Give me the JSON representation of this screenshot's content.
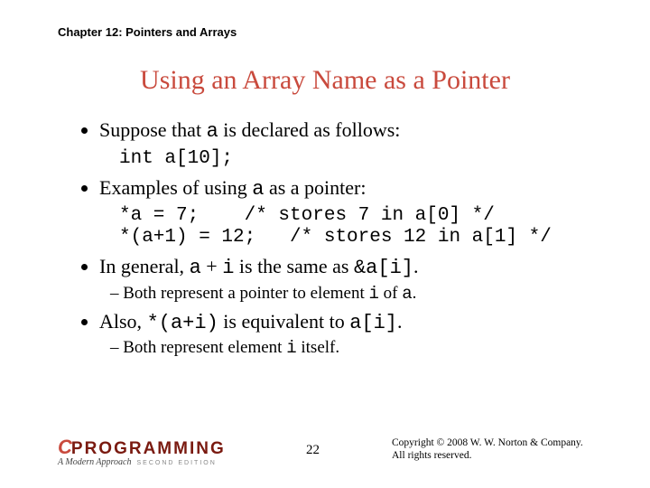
{
  "chapter": "Chapter 12: Pointers and Arrays",
  "title": "Using an Array Name as a Pointer",
  "b1": {
    "pre": "Suppose that ",
    "code": "a",
    "post": " is declared as follows:"
  },
  "code1": "int a[10];",
  "b2": {
    "pre": "Examples of using ",
    "code": "a",
    "post": " as a pointer:"
  },
  "code2": "*a = 7;    /* stores 7 in a[0] */\n*(a+1) = 12;   /* stores 12 in a[1] */",
  "b3": {
    "p1": "In general, ",
    "c1": "a",
    "p2": " + ",
    "c2": "i",
    "p3": " is the same as ",
    "c3": "&a[i]",
    "p4": "."
  },
  "s3": {
    "p1": "Both represent a pointer to element ",
    "c1": "i",
    "p2": " of ",
    "c2": "a",
    "p3": "."
  },
  "b4": {
    "p1": "Also, ",
    "c1": "*(a+i)",
    "p2": " is equivalent to ",
    "c2": "a[i]",
    "p3": "."
  },
  "s4": {
    "p1": "Both represent element ",
    "c1": "i",
    "p2": " itself."
  },
  "logo": {
    "c": "C",
    "prog": "PROGRAMMING",
    "sub": "A Modern Approach",
    "ed": "SECOND EDITION"
  },
  "page": "22",
  "copy1": "Copyright © 2008 W. W. Norton & Company.",
  "copy2": "All rights reserved."
}
